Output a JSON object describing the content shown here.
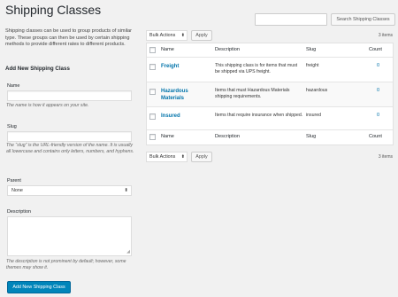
{
  "page": {
    "title": "Shipping Classes"
  },
  "search": {
    "button_label": "Search Shipping Classes",
    "value": ""
  },
  "intro": "Shipping classes can be used to group products of similar type. These groups can then be used by certain shipping methods to provide different rates to different products.",
  "form": {
    "heading": "Add New Shipping Class",
    "name_label": "Name",
    "name_value": "",
    "name_help": "The name is how it appears on your site.",
    "slug_label": "Slug",
    "slug_value": "",
    "slug_help": "The “slug” is the URL-friendly version of the name. It is usually all lowercase and contains only letters, numbers, and hyphens.",
    "parent_label": "Parent",
    "parent_selected": "None",
    "description_label": "Description",
    "description_value": "",
    "description_help": "The description is not prominent by default; however, some themes may show it.",
    "submit_label": "Add New Shipping Class"
  },
  "bulk_top": {
    "selected": "Bulk Actions",
    "apply_label": "Apply",
    "items_count": "3 items"
  },
  "bulk_bottom": {
    "selected": "Bulk Actions",
    "apply_label": "Apply",
    "items_count": "3 items"
  },
  "table": {
    "columns": [
      "Name",
      "Description",
      "Slug",
      "Count"
    ],
    "rows": [
      {
        "name": "Freight",
        "description": "This shipping class is for items that must be shipped via UPS freight.",
        "slug": "freight",
        "count": "0"
      },
      {
        "name": "Hazardous Materials",
        "description": "Items that must Hazardous Materials shipping requirements.",
        "slug": "hazardous",
        "count": "0"
      },
      {
        "name": "Insured",
        "description": "Items that require insurance when shipped.",
        "slug": "insured",
        "count": "0"
      }
    ]
  },
  "colors": {
    "link": "#0073aa",
    "primary": "#0085ba",
    "background": "#f1f1f1"
  },
  "icons": {
    "select_caret": "chevron-updown-icon",
    "resize": "resize-grip-icon"
  }
}
